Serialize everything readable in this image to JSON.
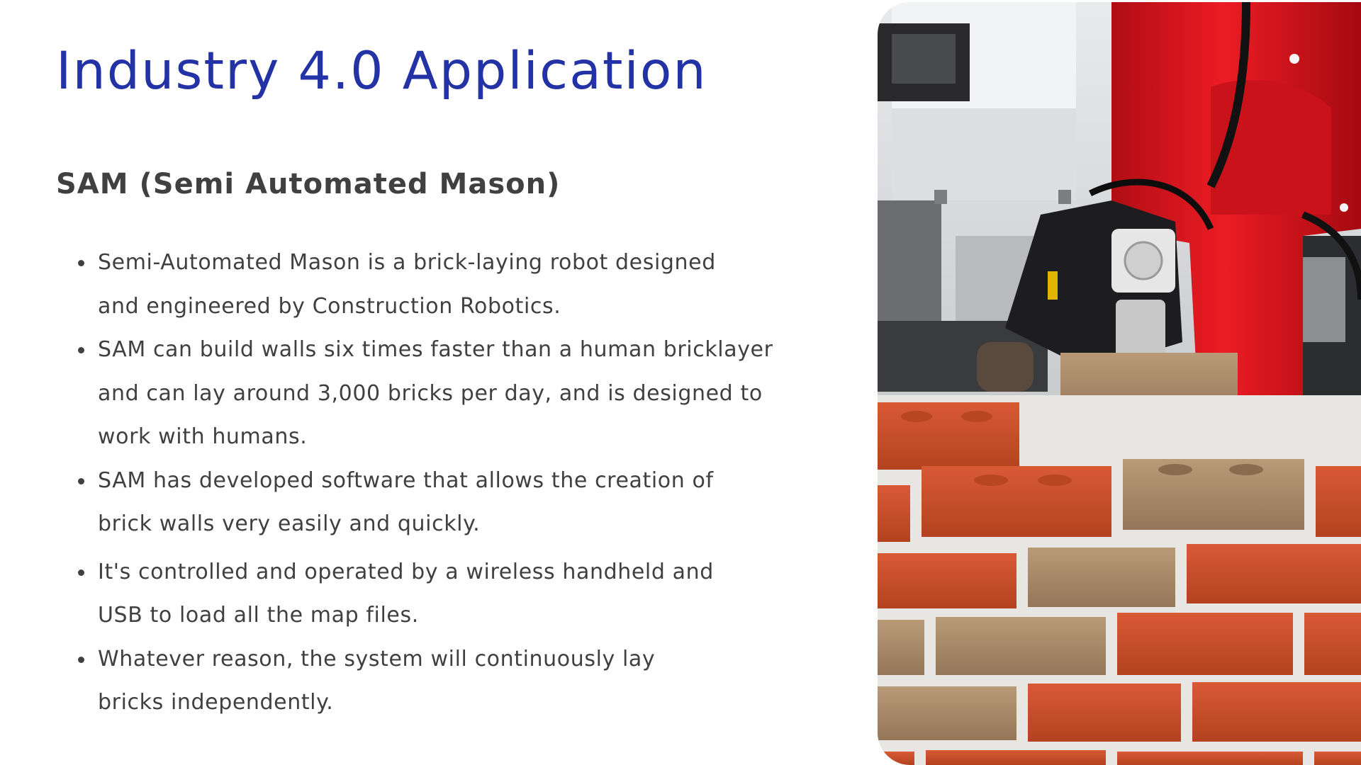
{
  "slide": {
    "title": "Industry 4.0 Application",
    "subtitle": "SAM (Semi Automated Mason)",
    "bullets": [
      {
        "lines": [
          "Semi-Automated Mason is a brick-laying robot designed",
          "and  engineered by Construction Robotics."
        ]
      },
      {
        "lines": [
          "SAM can build walls six times faster than a human bricklayer",
          "and  can lay around 3,000 bricks per day, and is designed to",
          "work  with humans."
        ]
      },
      {
        "lines": [
          "SAM has developed software that allows the creation of",
          "brick  walls very easily and quickly."
        ]
      },
      {
        "lines": [
          "It's controlled and operated by a wireless handheld and",
          "USB to  load all the map files."
        ]
      },
      {
        "lines": [
          "Whatever reason, the system will continuously lay",
          "bricks  independently."
        ]
      }
    ]
  },
  "colors": {
    "title": "#2332a4",
    "body_text": "#404040",
    "robot_red": "#e0141c",
    "brick_red": "#c9502e",
    "brick_tan": "#a88a6a",
    "mortar": "#e8e6e2"
  },
  "image": {
    "icon": "robot-bricklaying-photo"
  }
}
